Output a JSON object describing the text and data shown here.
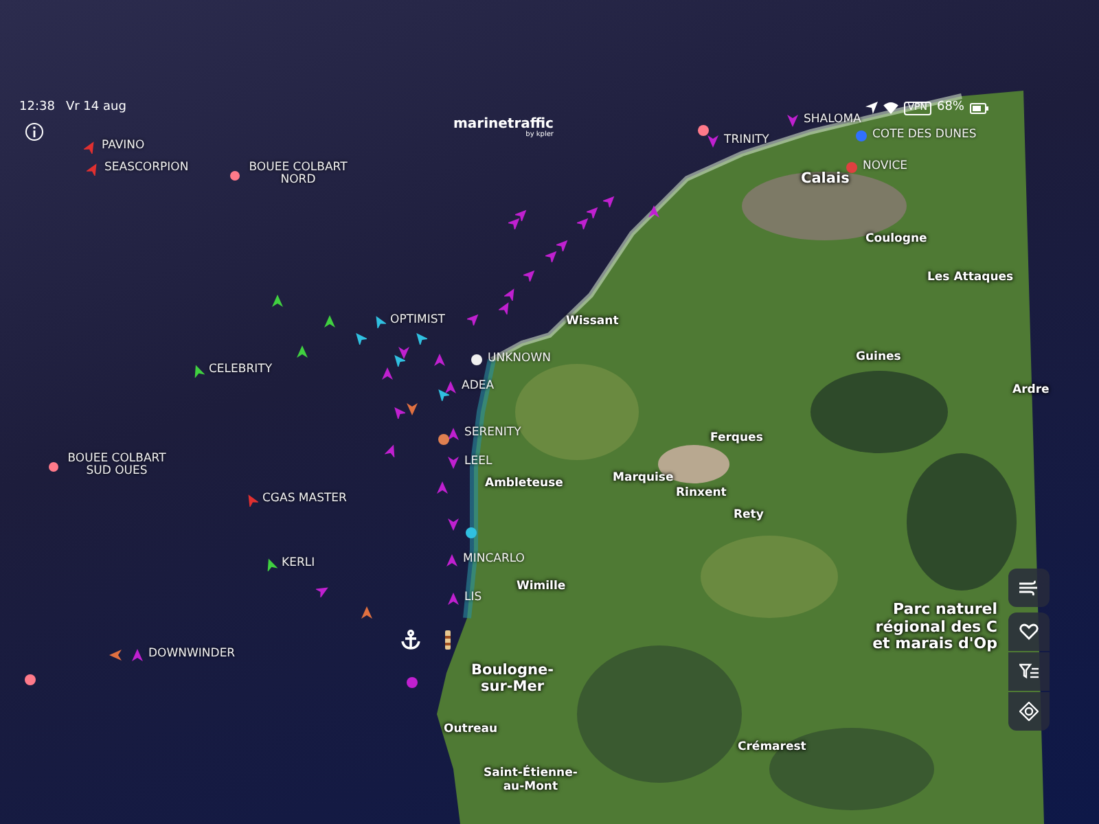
{
  "status_bar": {
    "time": "12:38",
    "date": "Vr 14 aug",
    "vpn": "VPN",
    "battery": "68%"
  },
  "logo": {
    "name": "marinetraffic",
    "byline": "by kpler"
  },
  "vessels": [
    {
      "name": "PAVINO",
      "kind": "arrow",
      "color": "#e03030"
    },
    {
      "name": "SEASCORPION",
      "kind": "arrow",
      "color": "#e03030"
    },
    {
      "name": "BOUEE COLBART NORD",
      "kind": "buoy",
      "color": "#ff7a8a"
    },
    {
      "name": "TRINITY",
      "kind": "arrow",
      "color": "#c020d0"
    },
    {
      "name": "SHALOMA",
      "kind": "arrow",
      "color": "#c020d0"
    },
    {
      "name": "COTE DES DUNES",
      "kind": "dot",
      "color": "#3070ff"
    },
    {
      "name": "NOVICE",
      "kind": "dot",
      "color": "#e04040"
    },
    {
      "name": "OPTIMIST",
      "kind": "arrow",
      "color": "#30c0e0"
    },
    {
      "name": "UNKNOWN",
      "kind": "dot",
      "color": "#f0f0f0"
    },
    {
      "name": "CELEBRITY",
      "kind": "arrow",
      "color": "#40d040"
    },
    {
      "name": "ADEA",
      "kind": "arrow",
      "color": "#c020d0"
    },
    {
      "name": "SERENITY",
      "kind": "arrow",
      "color": "#c020d0"
    },
    {
      "name": "LEEL",
      "kind": "arrow",
      "color": "#c020d0"
    },
    {
      "name": "CGAS MASTER",
      "kind": "arrow",
      "color": "#e03030"
    },
    {
      "name": "BOUEE COLBART SUD OUES",
      "kind": "buoy",
      "color": "#ff7a8a"
    },
    {
      "name": "KERLI",
      "kind": "arrow",
      "color": "#40d040"
    },
    {
      "name": "MINCARLO",
      "kind": "arrow",
      "color": "#c020d0"
    },
    {
      "name": "LIS",
      "kind": "arrow",
      "color": "#c020d0"
    },
    {
      "name": "DOWNWINDER",
      "kind": "arrow",
      "color": "#c020d0"
    }
  ],
  "markers": [
    {
      "kind": "arrow",
      "color": "#c020d0"
    },
    {
      "kind": "arrow",
      "color": "#c020d0"
    },
    {
      "kind": "arrow",
      "color": "#c020d0"
    },
    {
      "kind": "arrow",
      "color": "#c020d0"
    },
    {
      "kind": "arrow",
      "color": "#c020d0"
    },
    {
      "kind": "arrow",
      "color": "#c020d0"
    },
    {
      "kind": "arrow",
      "color": "#c020d0"
    },
    {
      "kind": "arrow",
      "color": "#c020d0"
    },
    {
      "kind": "arrow",
      "color": "#c020d0"
    },
    {
      "kind": "arrow",
      "color": "#c020d0"
    },
    {
      "kind": "arrow",
      "color": "#c020d0"
    },
    {
      "kind": "arrow",
      "color": "#40d040"
    },
    {
      "kind": "arrow",
      "color": "#40d040"
    },
    {
      "kind": "arrow",
      "color": "#40d040"
    },
    {
      "kind": "arrow",
      "color": "#30c0e0"
    },
    {
      "kind": "arrow",
      "color": "#30c0e0"
    },
    {
      "kind": "arrow",
      "color": "#c020d0"
    },
    {
      "kind": "arrow",
      "color": "#30c0e0"
    },
    {
      "kind": "arrow",
      "color": "#c020d0"
    },
    {
      "kind": "arrow",
      "color": "#30c0e0"
    },
    {
      "kind": "arrow",
      "color": "#c020d0"
    },
    {
      "kind": "arrow",
      "color": "#c020d0"
    },
    {
      "kind": "arrow",
      "color": "#c020d0"
    },
    {
      "kind": "arrow",
      "color": "#c020d0"
    },
    {
      "kind": "dot",
      "color": "#30c0e0"
    },
    {
      "kind": "arrow",
      "color": "#c020d0"
    },
    {
      "kind": "arrow",
      "color": "#e07040"
    },
    {
      "kind": "arrow",
      "color": "#c020d0"
    },
    {
      "kind": "dot",
      "color": "#ff7a8a"
    },
    {
      "kind": "dot",
      "color": "#c020d0"
    },
    {
      "kind": "arrow",
      "color": "#e07040"
    },
    {
      "kind": "dot",
      "color": "#e08050"
    },
    {
      "kind": "dot",
      "color": "#ff7a8a"
    },
    {
      "kind": "arrow",
      "color": "#c020d0"
    },
    {
      "kind": "arrow",
      "color": "#e07040"
    }
  ],
  "places": [
    {
      "name": "Calais",
      "kind": "city"
    },
    {
      "name": "Coulogne",
      "kind": "town"
    },
    {
      "name": "Les Attaques",
      "kind": "town"
    },
    {
      "name": "Wissant",
      "kind": "town"
    },
    {
      "name": "Guines",
      "kind": "town"
    },
    {
      "name": "Ardre",
      "kind": "town"
    },
    {
      "name": "Ferques",
      "kind": "town"
    },
    {
      "name": "Marquise",
      "kind": "town"
    },
    {
      "name": "Rinxent",
      "kind": "town"
    },
    {
      "name": "Rety",
      "kind": "town"
    },
    {
      "name": "Ambleteuse",
      "kind": "town"
    },
    {
      "name": "Wimille",
      "kind": "town"
    },
    {
      "name": "Boulogne-\nsur-Mer",
      "kind": "city"
    },
    {
      "name": "Outreau",
      "kind": "town"
    },
    {
      "name": "Saint-Étienne-\nau-Mont",
      "kind": "town"
    },
    {
      "name": "Crémarest",
      "kind": "town"
    },
    {
      "name": "Parc naturel\nrégional des C\net marais d'Op",
      "kind": "park"
    }
  ]
}
